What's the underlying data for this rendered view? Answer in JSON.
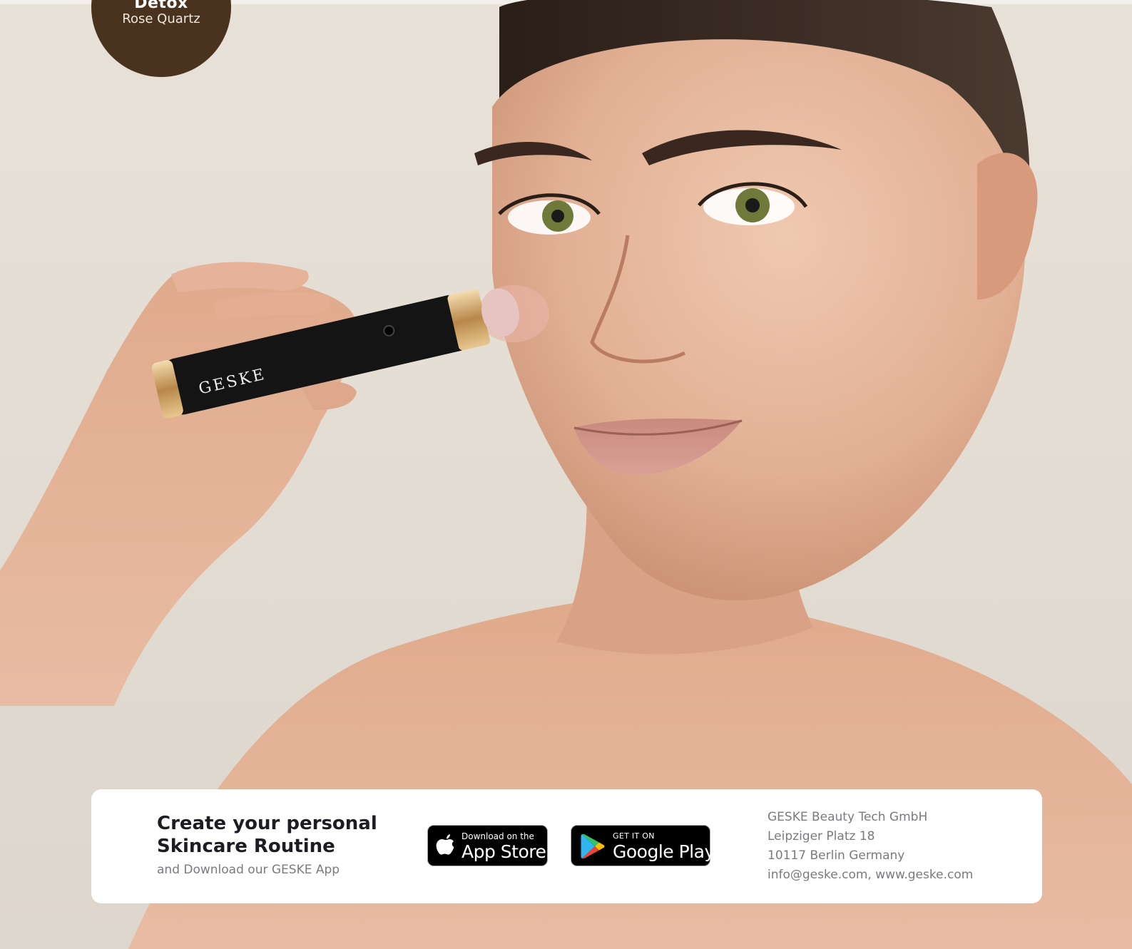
{
  "badge": {
    "title": "Detox",
    "subtitle": "Rose Quartz"
  },
  "device": {
    "brand_text": "GESKE"
  },
  "cta": {
    "title": "Create your personal Skincare Routine",
    "subtitle": "and Download our GESKE App"
  },
  "app_store": {
    "small_text": "Download on the",
    "big_text": "App Store",
    "icon": "apple-icon"
  },
  "google_play": {
    "small_text": "GET IT ON",
    "big_text": "Google Play",
    "icon": "google-play-icon"
  },
  "address": {
    "company": "GESKE Beauty Tech GmbH",
    "street": "Leipziger Platz 18",
    "city": "10117 Berlin Germany",
    "contact": "info@geske.com, www.geske.com"
  },
  "colors": {
    "background": "#e6e0d7",
    "badge": "#4a331e",
    "card": "#ffffff",
    "text_dark": "#1c1c22",
    "text_muted": "#7a7a80"
  }
}
